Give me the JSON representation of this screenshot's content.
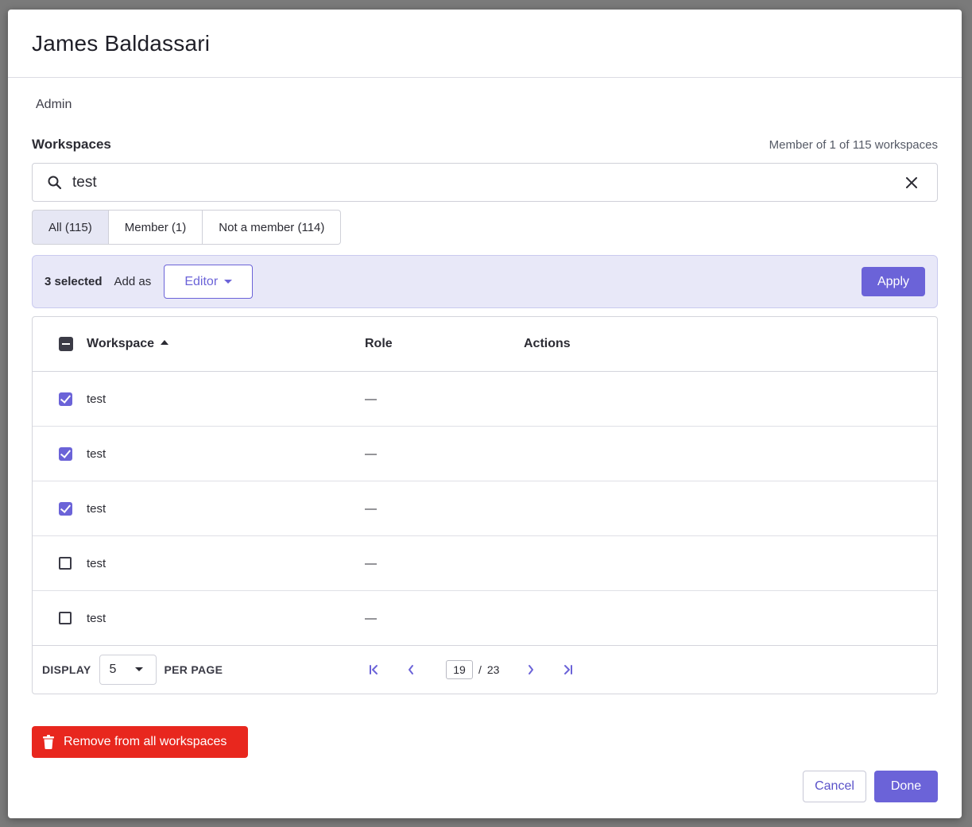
{
  "dialog": {
    "title": "James Baldassari",
    "role_label": "Admin"
  },
  "workspaces": {
    "title": "Workspaces",
    "membership_summary": "Member of 1 of 115 workspaces",
    "search": {
      "value": "test"
    },
    "tabs": [
      {
        "label": "All (115)",
        "active": true
      },
      {
        "label": "Member (1)",
        "active": false
      },
      {
        "label": "Not a member (114)",
        "active": false
      }
    ]
  },
  "bulk_bar": {
    "selected_label": "3 selected",
    "add_as_label": "Add as",
    "role_value": "Editor",
    "apply_label": "Apply"
  },
  "table": {
    "headers": {
      "workspace": "Workspace",
      "role": "Role",
      "actions": "Actions"
    },
    "sort": "ascending",
    "header_checkbox": "indeterminate",
    "rows": [
      {
        "name": "test",
        "role": "—",
        "checked": true
      },
      {
        "name": "test",
        "role": "—",
        "checked": true
      },
      {
        "name": "test",
        "role": "—",
        "checked": true
      },
      {
        "name": "test",
        "role": "—",
        "checked": false
      },
      {
        "name": "test",
        "role": "—",
        "checked": false
      }
    ]
  },
  "pagination": {
    "display_label": "DISPLAY",
    "per_page_value": "5",
    "per_page_label": "PER PAGE",
    "current_page": "19",
    "separator": "/",
    "total_pages": "23"
  },
  "footer": {
    "remove_label": "Remove from all workspaces",
    "cancel_label": "Cancel",
    "done_label": "Done"
  },
  "colors": {
    "accent": "#6b63d8",
    "danger": "#e8271e",
    "selection_bar_bg": "#e8e8f8"
  }
}
